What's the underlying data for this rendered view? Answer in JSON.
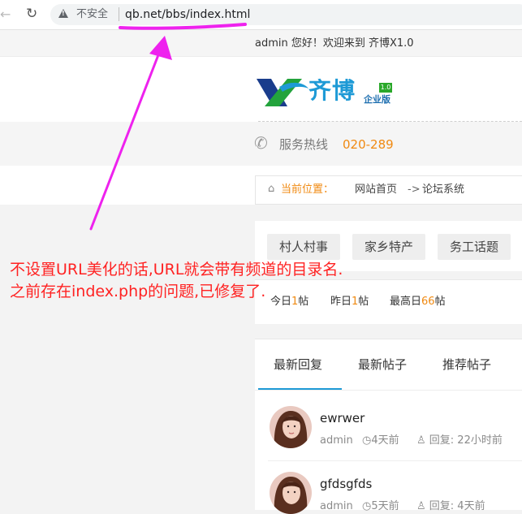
{
  "browser": {
    "back_icon": "arrow-left-icon",
    "reload_icon": "reload-icon",
    "security_label": "不安全",
    "url": "qb.net/bbs/index.html"
  },
  "header": {
    "welcome": "admin 您好！欢迎来到 齐博X1.0",
    "logo_text": "齐博",
    "logo_badge": "1.0",
    "logo_edition": "企业版",
    "hotline_label": "服务热线",
    "hotline_number": "020-289"
  },
  "breadcrumb": {
    "label": "当前位置：",
    "home": "网站首页",
    "arrow": "->",
    "current": "论坛系统"
  },
  "categories": [
    "村人村事",
    "家乡特产",
    "务工话题"
  ],
  "stats": [
    {
      "label": "今日",
      "value": "1",
      "unit": "帖"
    },
    {
      "label": "昨日",
      "value": "1",
      "unit": "帖"
    },
    {
      "label": "最高日",
      "value": "66",
      "unit": "帖"
    }
  ],
  "tabs": [
    "最新回复",
    "最新帖子",
    "推荐帖子"
  ],
  "posts": [
    {
      "title": "ewrwer",
      "author": "admin",
      "time": "4天前",
      "reply": "回复: 22小时前"
    },
    {
      "title": "gfdsgfds",
      "author": "admin",
      "time": "5天前",
      "reply": "回复: 4天前"
    }
  ],
  "annotation": {
    "line1": "不设置URL美化的话,URL就会带有频道的目录名.",
    "line2": "之前存在index.php的问题,已修复了."
  },
  "colors": {
    "accent": "#1e9ad6",
    "orange": "#f08a12",
    "annotation_red": "#ff2222",
    "marker_magenta": "#ee22ee"
  }
}
